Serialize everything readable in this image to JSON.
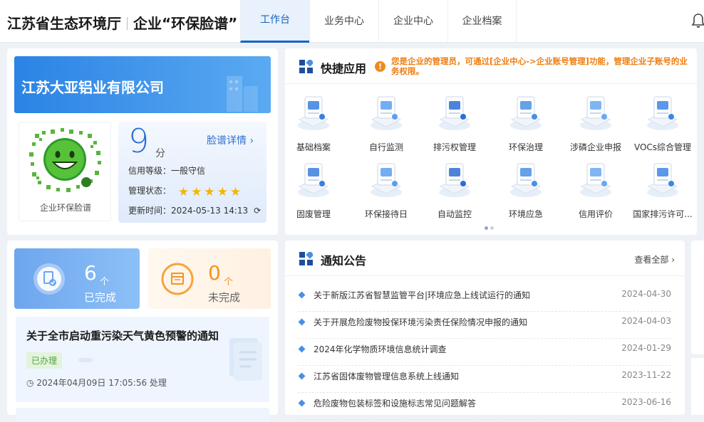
{
  "header": {
    "title_left": "江苏省生态环境厅",
    "title_right": "企业“环保脸谱”",
    "tabs": [
      {
        "label": "工作台",
        "active": true
      },
      {
        "label": "业务中心",
        "active": false
      },
      {
        "label": "企业中心",
        "active": false
      },
      {
        "label": "企业档案",
        "active": false
      }
    ],
    "bell_icon": "bell-icon"
  },
  "company": {
    "name": "江苏大亚铝业有限公司",
    "qr_label": "企业环保脸谱",
    "score": "9",
    "score_unit": "分",
    "detail_link": "脸谱详情",
    "credit_label": "信用等级：",
    "credit_value": "一般守信",
    "status_label": "管理状态：",
    "stars": 5,
    "update_label": "更新时间：",
    "update_value": "2024-05-13 14:13"
  },
  "quick_apps": {
    "title": "快捷应用",
    "tip": "您是企业的管理员，可通过[企业中心->企业账号管理]功能，管理企业子账号的业务权限。",
    "items": [
      {
        "label": "基础档案",
        "icon": "archive-icon"
      },
      {
        "label": "自行监测",
        "icon": "self-monitor-icon"
      },
      {
        "label": "排污权管理",
        "icon": "discharge-right-icon"
      },
      {
        "label": "环保治理",
        "icon": "governance-icon"
      },
      {
        "label": "涉磷企业申报",
        "icon": "phosphorus-report-icon"
      },
      {
        "label": "VOCs综合管理",
        "icon": "vocs-icon"
      },
      {
        "label": "固废管理",
        "icon": "solid-waste-icon"
      },
      {
        "label": "环保接待日",
        "icon": "reception-day-icon"
      },
      {
        "label": "自动监控",
        "icon": "auto-monitor-icon"
      },
      {
        "label": "环境应急",
        "icon": "emergency-icon"
      },
      {
        "label": "信用评价",
        "icon": "credit-eval-icon"
      },
      {
        "label": "国家排污许可...",
        "icon": "permit-icon"
      }
    ]
  },
  "tasks": {
    "done_count": "6",
    "done_unit": "个",
    "done_label": "已完成",
    "todo_count": "0",
    "todo_unit": "个",
    "todo_label": "未完成",
    "item_title": "关于全市启动重污染天气黄色预警的通知",
    "item_badge": "已办理",
    "item_time": "2024年04月09日 17:05:56 处理"
  },
  "notices": {
    "title": "通知公告",
    "view_all": "查看全部",
    "items": [
      {
        "title": "关于新版江苏省智慧监管平台|环境应急上线试运行的通知",
        "date": "2024-04-30"
      },
      {
        "title": "关于开展危险废物投保环境污染责任保险情况申报的通知",
        "date": "2024-04-03"
      },
      {
        "title": "2024年化学物质环境信息统计调查",
        "date": "2024-01-29"
      },
      {
        "title": "江苏省固体废物管理信息系统上线通知",
        "date": "2023-11-22"
      },
      {
        "title": "危险废物包装标签和设施标志常见问题解答",
        "date": "2023-06-16"
      }
    ]
  },
  "colors": {
    "brand": "#1565c0",
    "accent": "#2c6fd3",
    "warning": "#ef7d10",
    "star": "#f5b400"
  }
}
